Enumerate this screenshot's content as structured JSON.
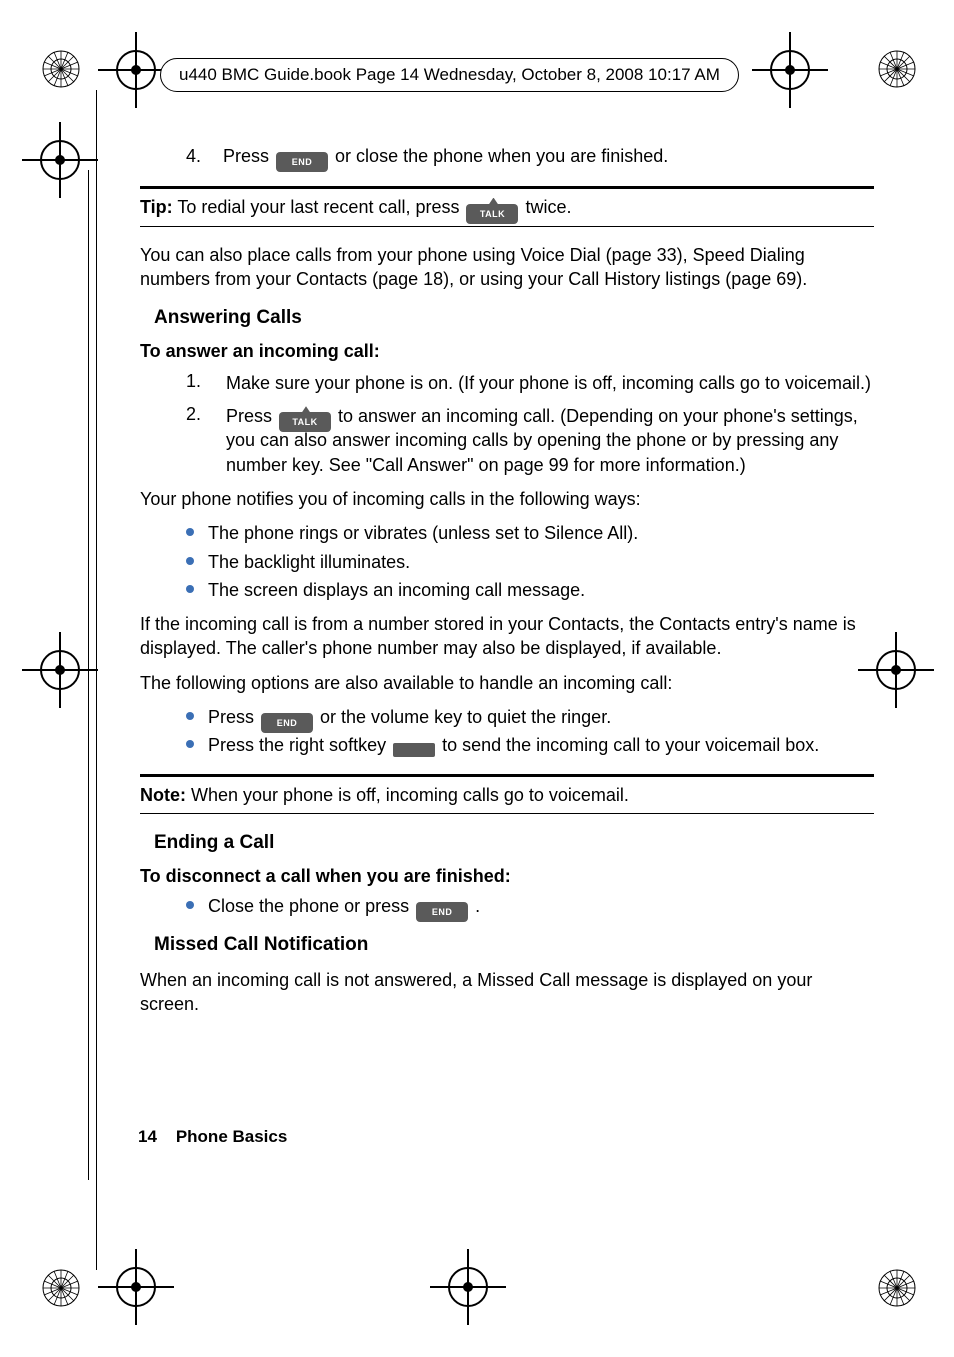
{
  "header": {
    "running_text": "u440 BMC Guide.book  Page 14  Wednesday, October 8, 2008  10:17 AM"
  },
  "step4": {
    "num": "4.",
    "before": "Press ",
    "after": " or close the phone when you are finished."
  },
  "tip": {
    "label": "Tip:",
    "before": " To redial your last recent call, press ",
    "after": " twice."
  },
  "para1": "You can also place calls from your phone using Voice Dial (page 33), Speed Dialing numbers from your Contacts (page 18), or using your Call History listings (page 69).",
  "answering": {
    "heading": "Answering Calls",
    "subhead": "To answer an incoming call:",
    "s1": {
      "num": "1.",
      "text": "Make sure your phone is on. (If your phone is off, incoming calls go to voicemail.)"
    },
    "s2": {
      "num": "2.",
      "before": "Press ",
      "after": " to answer an incoming call. (Depending on your phone's settings, you can also answer incoming calls by opening the phone or by pressing any number key. See \"Call Answer\" on page 99 for more information.)"
    },
    "notify_lead": "Your phone notifies you of incoming calls in the following ways:",
    "b1": "The phone rings or vibrates (unless set to Silence All).",
    "b2": "The backlight illuminates.",
    "b3": "The screen displays an incoming call message.",
    "contacts_para": "If the incoming call is from a number stored in your Contacts, the Contacts entry's name is displayed. The caller's phone number may also be displayed, if available.",
    "options_lead": "The following options are also available to handle an incoming call:",
    "o1_before": "Press ",
    "o1_after": " or the volume key to quiet the ringer.",
    "o2_before": "Press the right softkey ",
    "o2_after": " to send the incoming call to your voicemail box."
  },
  "note": {
    "label": "Note:",
    "text": " When your phone is off, incoming calls go to voicemail."
  },
  "ending": {
    "heading": "Ending a Call",
    "subhead": "To disconnect a call when you are finished:",
    "b_before": "Close the phone or press ",
    "b_after": "."
  },
  "missed": {
    "heading": "Missed Call Notification",
    "para": "When an incoming call is not answered, a Missed Call message is displayed on your screen."
  },
  "footer": {
    "page": "14",
    "section": "Phone Basics"
  },
  "icons": {
    "end": "END",
    "talk": "TALK"
  }
}
